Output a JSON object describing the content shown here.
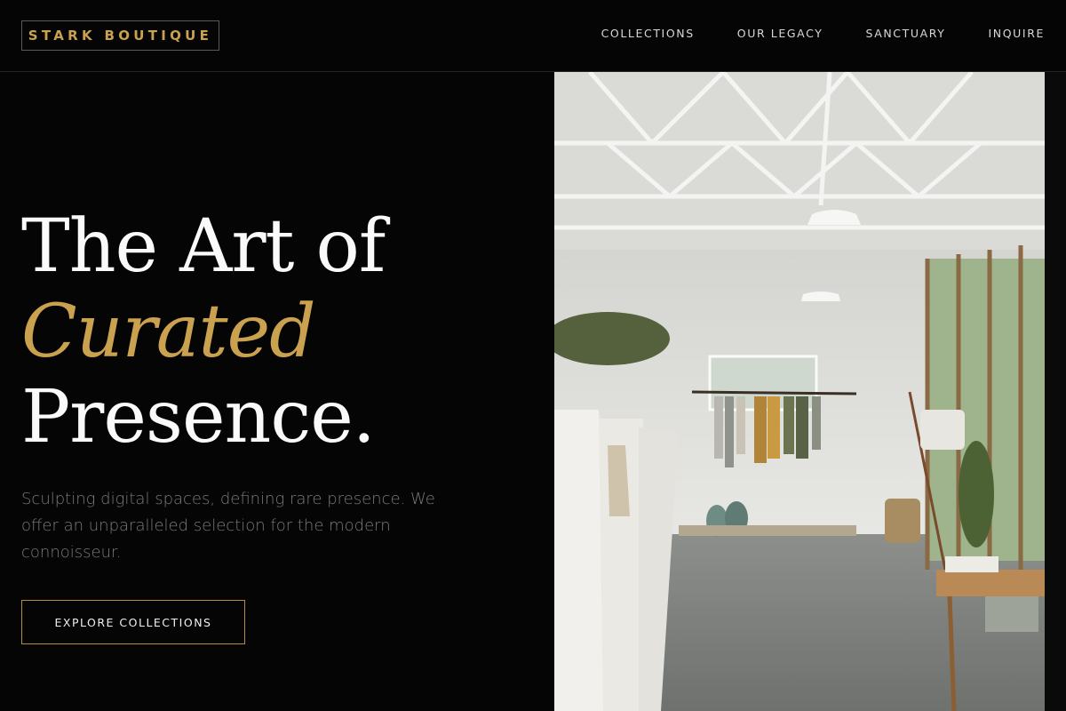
{
  "brand": {
    "name": "STARK BOUTIQUE",
    "accent_color": "#c9a14f"
  },
  "nav": {
    "items": [
      {
        "label": "COLLECTIONS"
      },
      {
        "label": "OUR LEGACY"
      },
      {
        "label": "SANCTUARY"
      },
      {
        "label": "INQUIRE"
      }
    ]
  },
  "hero": {
    "headline_line1": "The Art of",
    "headline_accent": "Curated",
    "headline_line3": "Presence.",
    "subtitle": "Sculpting digital spaces, defining rare presence. We offer an unparalleled selection for the modern connoisseur.",
    "cta_label": "EXPLORE COLLECTIONS",
    "image": {
      "subject": "boutique-interior-photo"
    }
  }
}
